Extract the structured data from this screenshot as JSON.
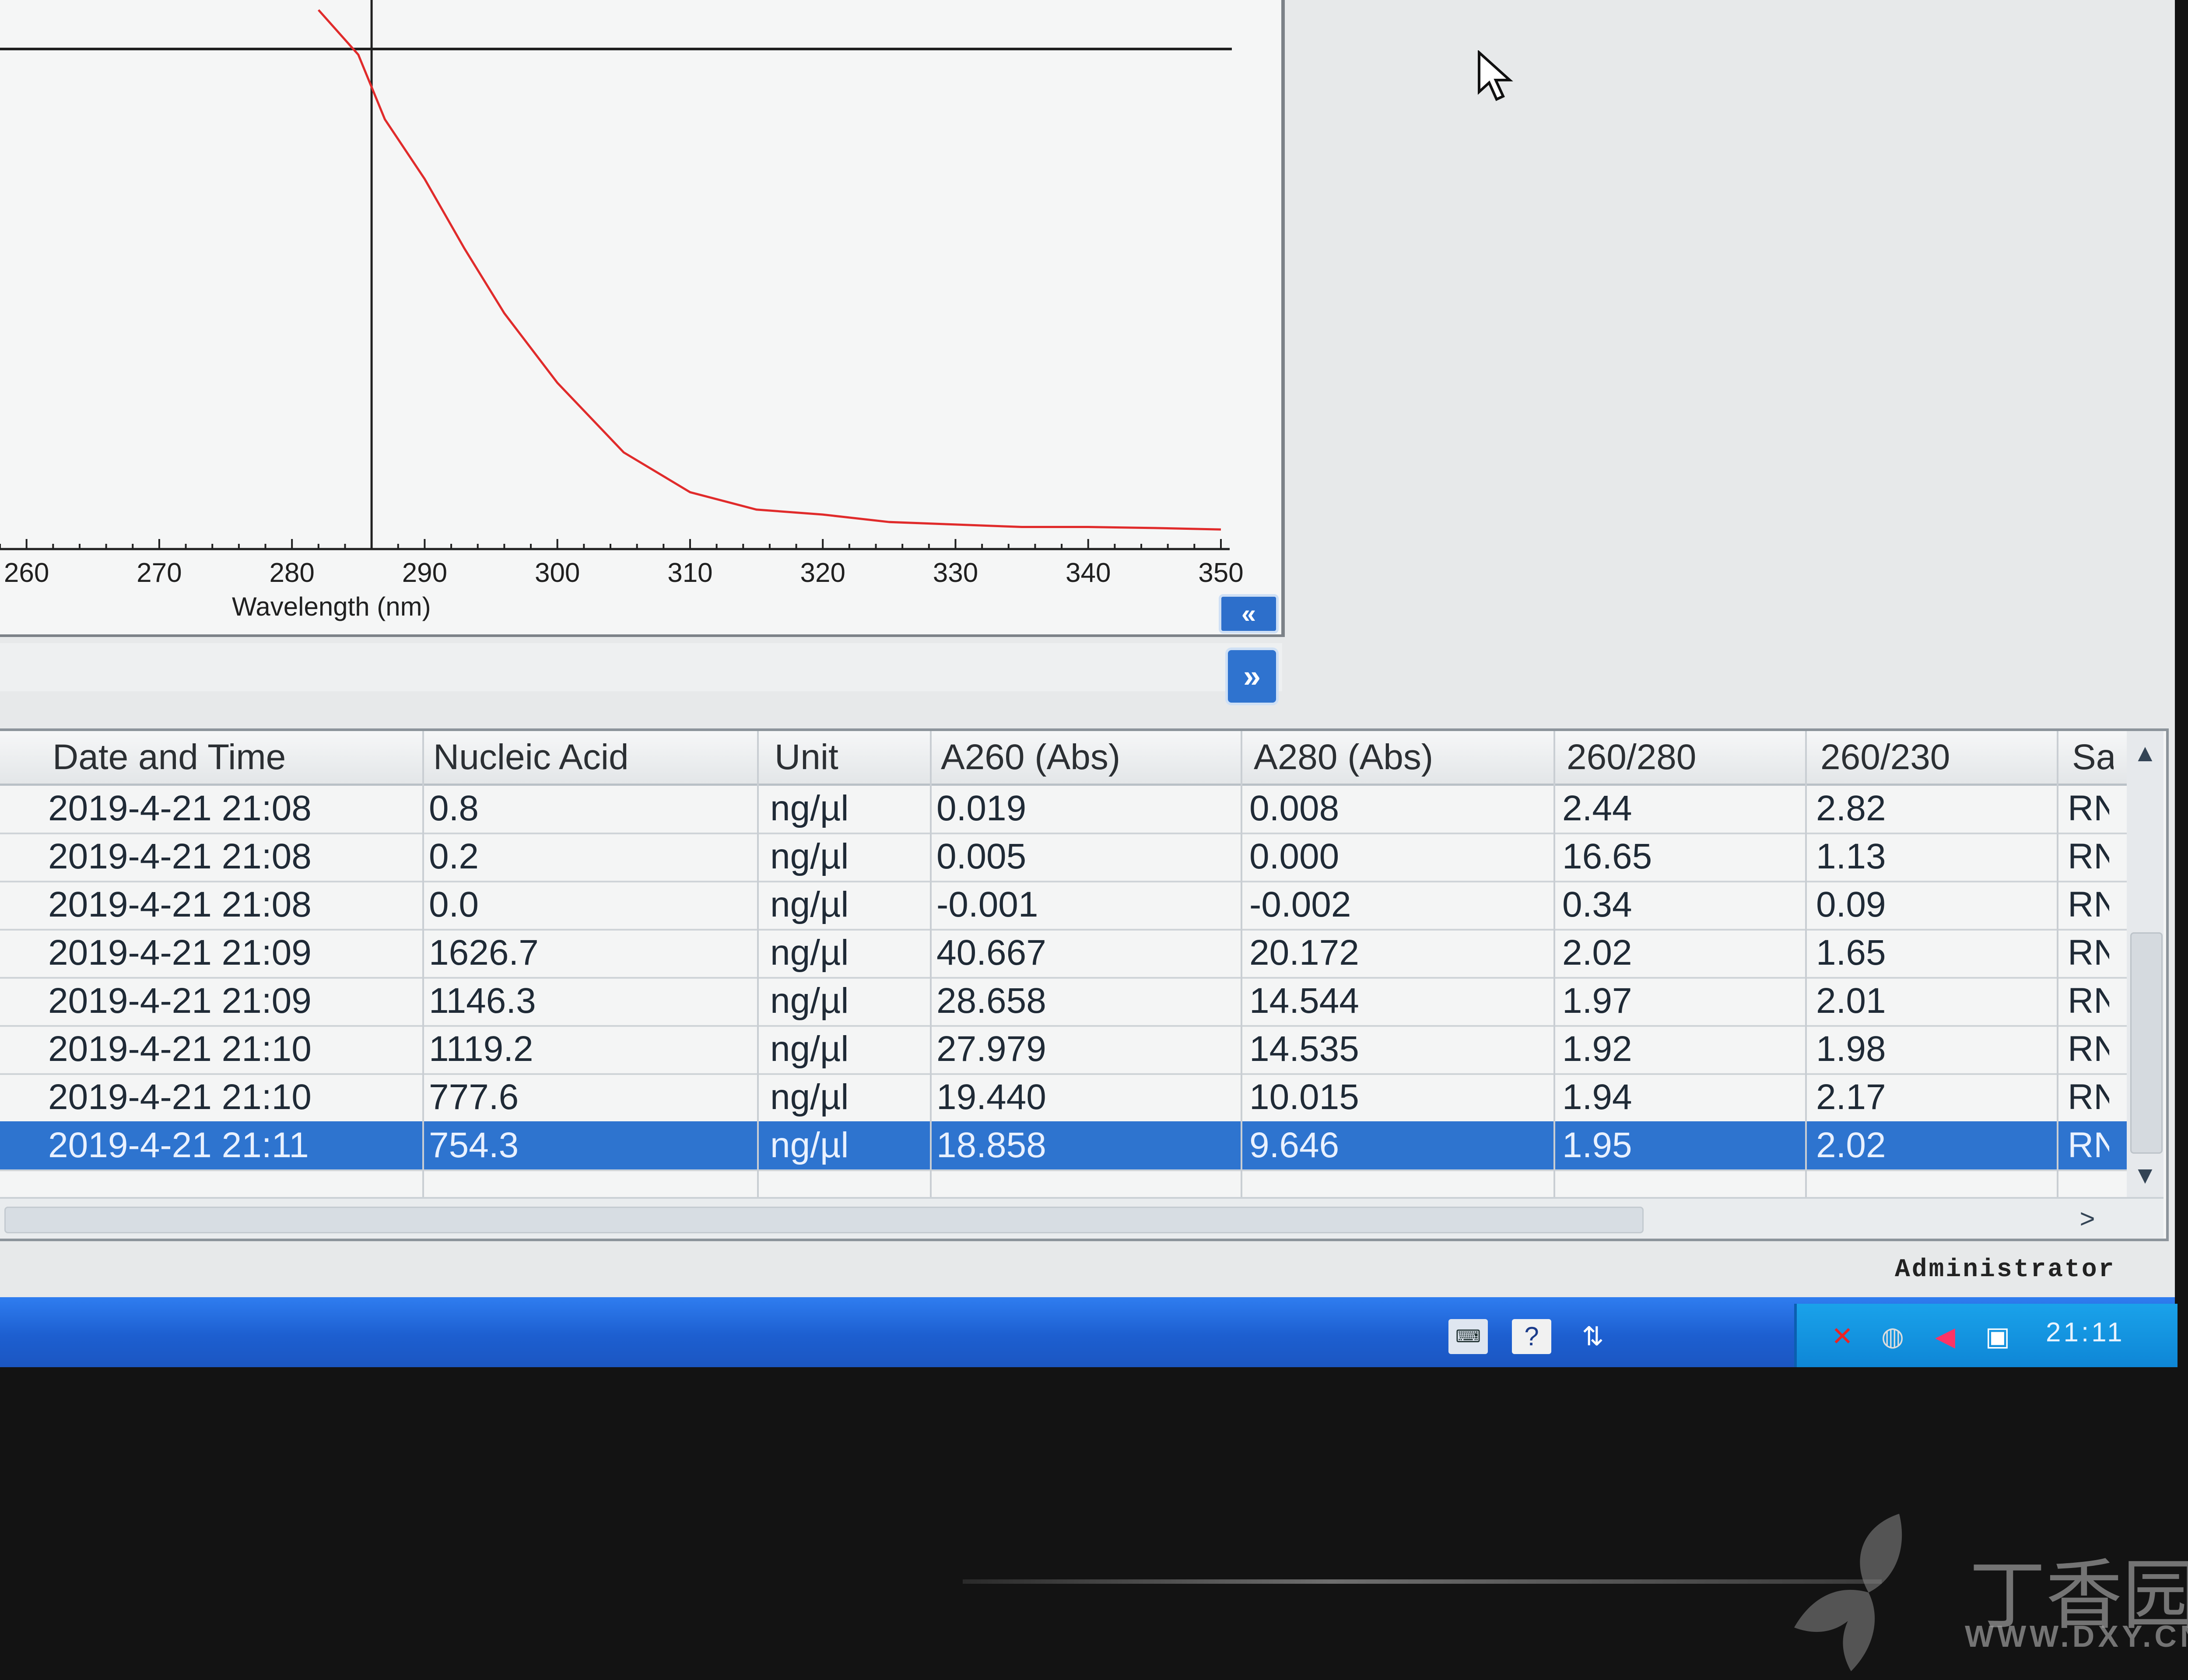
{
  "chart": {
    "x_axis_label": "Wavelength (nm)",
    "x_ticks": [
      "260",
      "270",
      "280",
      "290",
      "300",
      "310",
      "320",
      "330",
      "340",
      "350"
    ],
    "line_color": "#e02b2b",
    "collapse_button": "«",
    "expand_button": "»"
  },
  "chart_data": {
    "type": "line",
    "xlabel": "Wavelength (nm)",
    "ylabel": "",
    "xlim": [
      258,
      350
    ],
    "cursor_x": 286,
    "series": [
      {
        "x": [
          282,
          285,
          287,
          290,
          293,
          296,
          300,
          305,
          310,
          315,
          320,
          325,
          330,
          335,
          340,
          345,
          350
        ],
        "y": [
          1.08,
          0.99,
          0.86,
          0.74,
          0.6,
          0.47,
          0.33,
          0.19,
          0.11,
          0.075,
          0.065,
          0.05,
          0.045,
          0.04,
          0.04,
          0.038,
          0.035
        ]
      }
    ]
  },
  "table": {
    "columns": [
      "Date and Time",
      "Nucleic Acid",
      "Unit",
      "A260 (Abs)",
      "A280 (Abs)",
      "260/280",
      "260/230",
      "Sa"
    ],
    "rows": [
      [
        "2019-4-21 21:08",
        "0.8",
        "ng/µl",
        "0.019",
        "0.008",
        "2.44",
        "2.82",
        "RN"
      ],
      [
        "2019-4-21 21:08",
        "0.2",
        "ng/µl",
        "0.005",
        "0.000",
        "16.65",
        "1.13",
        "RN"
      ],
      [
        "2019-4-21 21:08",
        "0.0",
        "ng/µl",
        "-0.001",
        "-0.002",
        "0.34",
        "0.09",
        "RN"
      ],
      [
        "2019-4-21 21:09",
        "1626.7",
        "ng/µl",
        "40.667",
        "20.172",
        "2.02",
        "1.65",
        "RN"
      ],
      [
        "2019-4-21 21:09",
        "1146.3",
        "ng/µl",
        "28.658",
        "14.544",
        "1.97",
        "2.01",
        "RN"
      ],
      [
        "2019-4-21 21:10",
        "1119.2",
        "ng/µl",
        "27.979",
        "14.535",
        "1.92",
        "1.98",
        "RN"
      ],
      [
        "2019-4-21 21:10",
        "777.6",
        "ng/µl",
        "19.440",
        "10.015",
        "1.94",
        "2.17",
        "RN"
      ],
      [
        "2019-4-21 21:11",
        "754.3",
        "ng/µl",
        "18.858",
        "9.646",
        "1.95",
        "2.02",
        "RN"
      ]
    ],
    "selected_row": 7,
    "selection_color": "#2e74cf"
  },
  "statusbar": {
    "user": "Administrator"
  },
  "taskbar": {
    "clock": "21:11",
    "icons": [
      "keyboard-icon",
      "help-icon",
      "network-icon",
      "safely-remove-icon",
      "speaker-icon",
      "monitor-icon"
    ]
  },
  "watermark": {
    "brand": "丁香园",
    "url": "WWW.DXY.CN"
  }
}
